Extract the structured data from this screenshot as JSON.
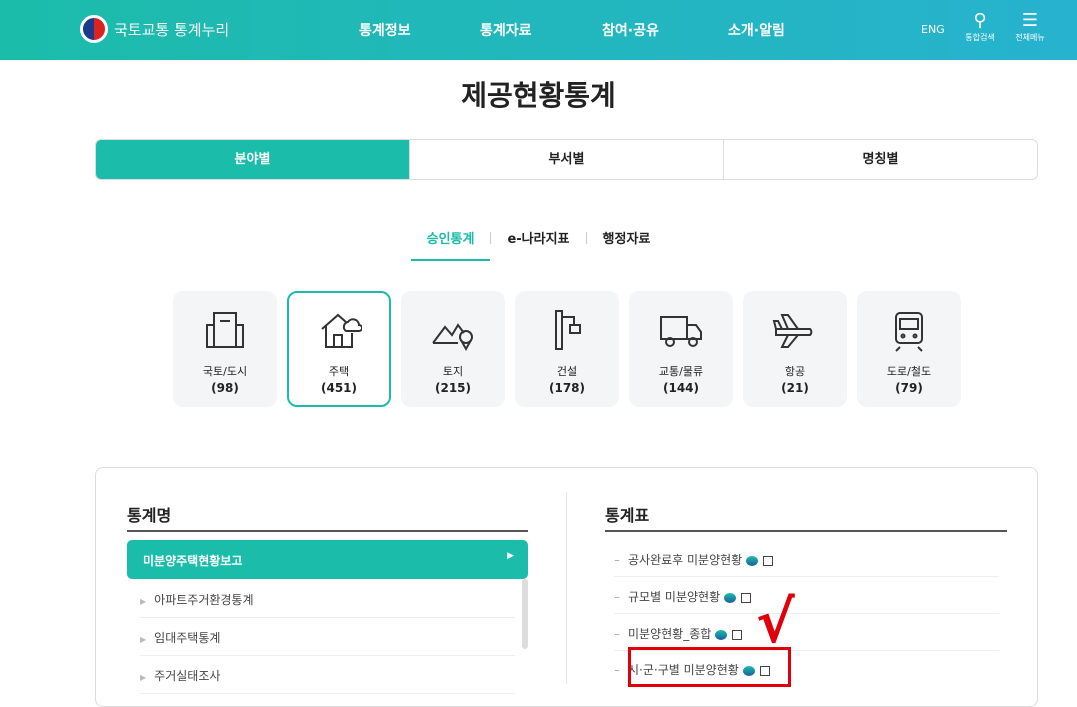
{
  "header": {
    "logo": "국토교통 통계누리",
    "nav": [
      "통계정보",
      "통계자료",
      "참여·공유",
      "소개·알림"
    ],
    "eng": "ENG",
    "search": "통합검색",
    "menu": "전체메뉴"
  },
  "title": "제공현황통계",
  "tabs": [
    "분야별",
    "부서별",
    "명칭별"
  ],
  "subtabs": [
    "승인통계",
    "e-나라지표",
    "행정자료"
  ],
  "categories": [
    {
      "name": "국토/도시",
      "count": "(98)"
    },
    {
      "name": "주택",
      "count": "(451)"
    },
    {
      "name": "토지",
      "count": "(215)"
    },
    {
      "name": "건설",
      "count": "(178)"
    },
    {
      "name": "교통/물류",
      "count": "(144)"
    },
    {
      "name": "항공",
      "count": "(21)"
    },
    {
      "name": "도로/철도",
      "count": "(79)"
    }
  ],
  "left": {
    "heading": "통계명",
    "active": "미분양주택현황보고",
    "items": [
      "아파트주거환경통계",
      "임대주택통계",
      "주거실태조사"
    ]
  },
  "right": {
    "heading": "통계표",
    "items": [
      "공사완료후 미분양현황",
      "규모별 미분양현황",
      "미분양현황_종합",
      "시·군·구별 미분양현황"
    ]
  },
  "annotation": "√",
  "colors": {
    "accent": "#1cbcaa",
    "highlight": "#e0000b"
  }
}
